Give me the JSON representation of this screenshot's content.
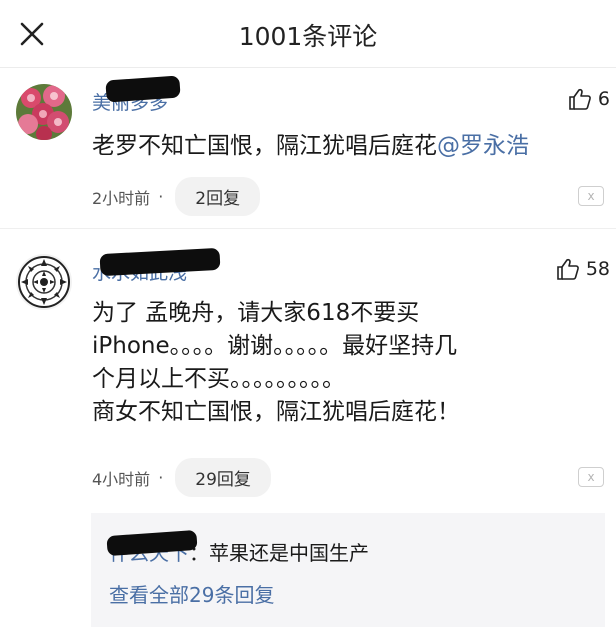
{
  "header": {
    "title": "1001条评论"
  },
  "comments": [
    {
      "username": "美丽多多",
      "likes": "6",
      "content": "老罗不知亡国恨，隔江犹唱后庭花",
      "mention": "@罗永浩",
      "time": "2小时前",
      "separator": "·",
      "replies_label": "2回复",
      "dislike_icon": "x"
    },
    {
      "username": "水水如此浅",
      "likes": "58",
      "content_lines": [
        "为了 孟晚舟，请大家618不要买",
        "iPhone。。。。谢谢。。。。。最好坚持几",
        "个月以上不买。。。。。。。。。",
        "商女不知亡国恨，隔江犹唱后庭花！"
      ],
      "time": "4小时前",
      "separator": "·",
      "replies_label": "29回复",
      "dislike_icon": "x",
      "reply_preview": {
        "user": "什么天下",
        "text": "：苹果还是中国生产",
        "view_all": "查看全部29条回复"
      }
    }
  ],
  "colors": {
    "link": "#4a6fa5",
    "text": "#1a1a1a",
    "pill_bg": "#f2f2f2",
    "reply_bg": "#f5f5f7"
  }
}
